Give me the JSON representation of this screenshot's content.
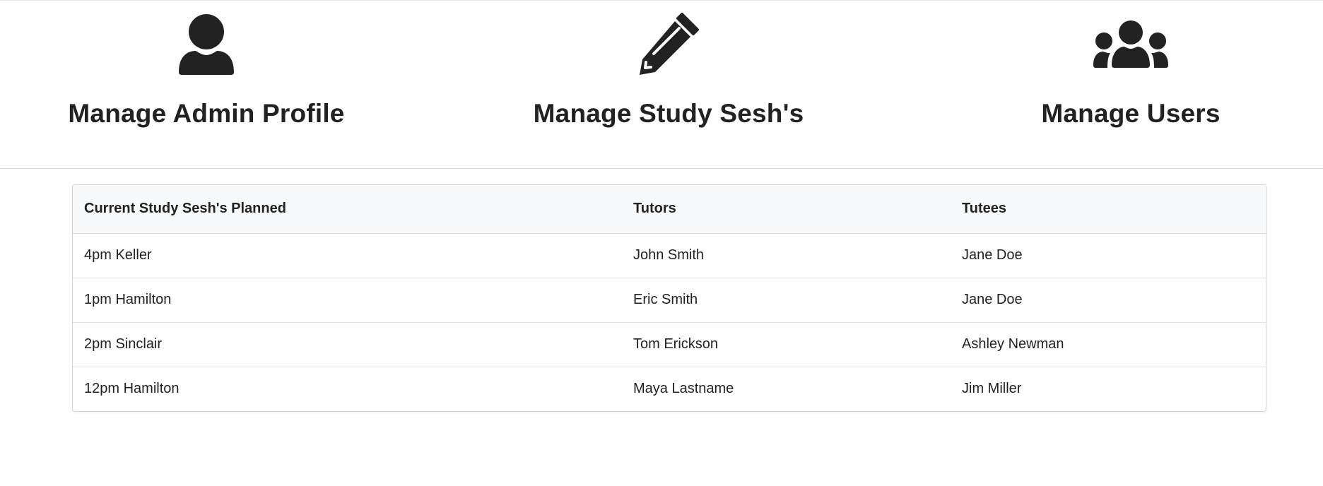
{
  "nav_cards": [
    {
      "title": "Manage Admin Profile",
      "icon": "user-icon"
    },
    {
      "title": "Manage Study Sesh's",
      "icon": "pencil-icon"
    },
    {
      "title": "Manage Users",
      "icon": "users-icon"
    }
  ],
  "table": {
    "headers": [
      "Current Study Sesh's Planned",
      "Tutors",
      "Tutees"
    ],
    "rows": [
      [
        "4pm Keller",
        "John Smith",
        "Jane Doe"
      ],
      [
        "1pm Hamilton",
        "Eric Smith",
        "Jane Doe"
      ],
      [
        "2pm Sinclair",
        "Tom Erickson",
        "Ashley Newman"
      ],
      [
        "12pm Hamilton",
        "Maya Lastname",
        "Jim Miller"
      ]
    ]
  },
  "colors": {
    "text": "#222222",
    "icon": "#222222",
    "header_bg": "#f8f9fa",
    "border": "#dddddd"
  }
}
